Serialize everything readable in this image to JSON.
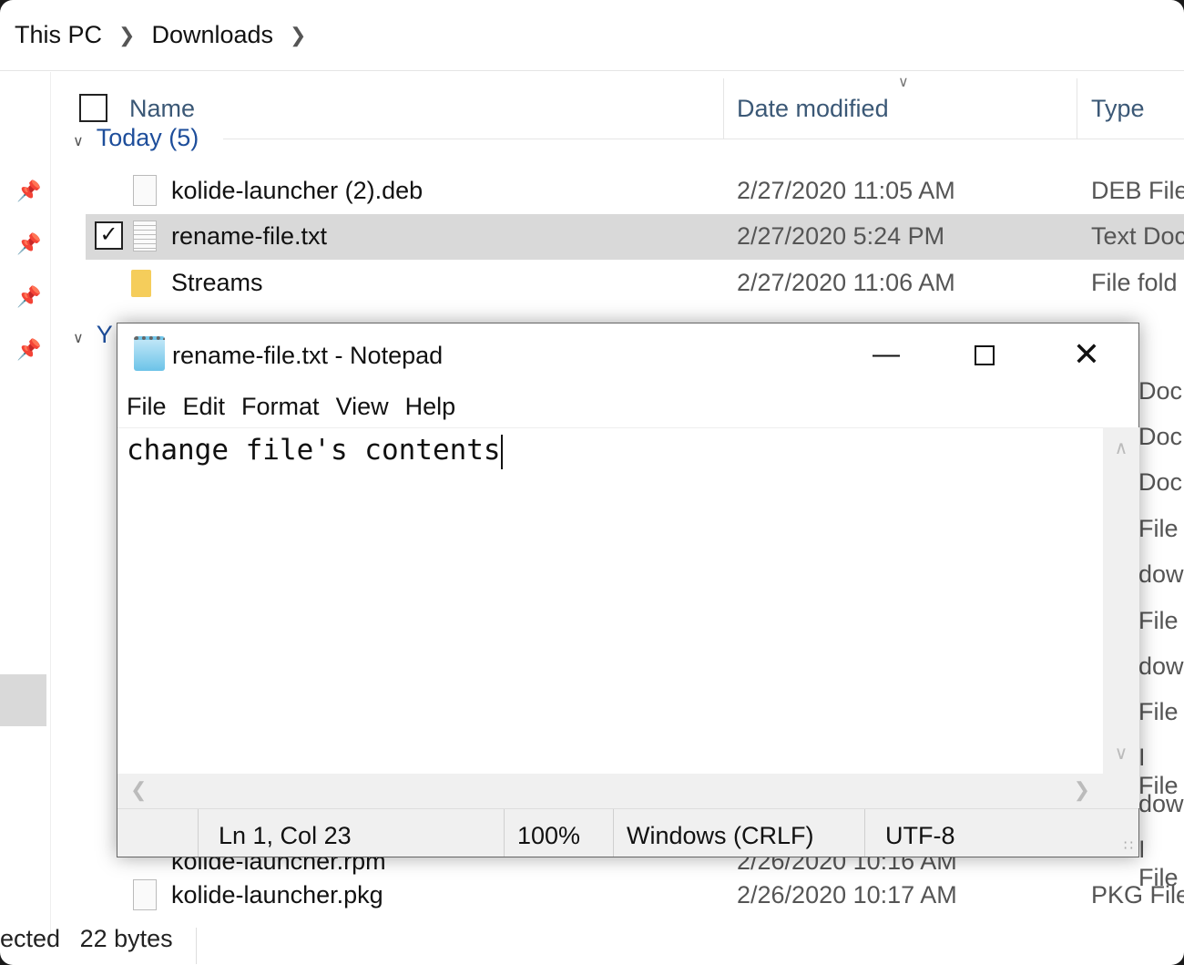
{
  "breadcrumb": [
    "This PC",
    "Downloads"
  ],
  "columns": {
    "name": "Name",
    "date": "Date modified",
    "type": "Type"
  },
  "groups": {
    "today": "Today (5)",
    "yesterday": "Y"
  },
  "rows": [
    {
      "name": "kolide-launcher (2).deb",
      "date": "2/27/2020 11:05 AM",
      "type": "DEB File",
      "icon": "file-icon"
    },
    {
      "name": "rename-file.txt",
      "date": "2/27/2020 5:24 PM",
      "type": "Text Doc",
      "icon": "text-file-icon",
      "selected": true
    },
    {
      "name": "Streams",
      "date": "2/27/2020 11:06 AM",
      "type": "File fold",
      "icon": "folder-icon"
    }
  ],
  "hidden_type_fragments": [
    "Doc",
    "Doc",
    "Doc",
    "File",
    "dow",
    "File",
    "dow",
    "File",
    "I File",
    "dow",
    "I File"
  ],
  "partial_row": {
    "name": "kolide-launcher.rpm",
    "date": "2/26/2020 10:16 AM"
  },
  "last_row": {
    "name": "kolide-launcher.pkg",
    "date": "2/26/2020 10:17 AM",
    "type": "PKG File"
  },
  "status": {
    "selected": "ected",
    "size": "22 bytes"
  },
  "notepad": {
    "title": "rename-file.txt - Notepad",
    "menu": [
      "File",
      "Edit",
      "Format",
      "View",
      "Help"
    ],
    "content": "change file's contents",
    "status": {
      "position": "Ln 1, Col 23",
      "zoom": "100%",
      "line_ending": "Windows (CRLF)",
      "encoding": "UTF-8"
    }
  }
}
